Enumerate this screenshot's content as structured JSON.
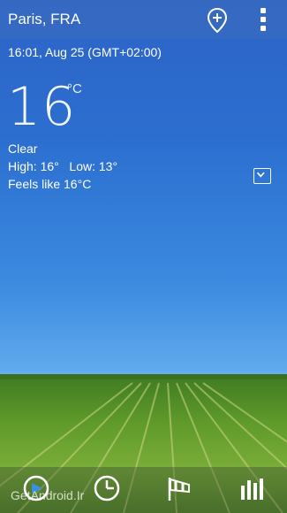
{
  "header": {
    "city": "Paris, FRA",
    "pin_icon": "add-location-pin-icon",
    "menu_icon": "overflow-menu-icon"
  },
  "weather": {
    "datetime": "16:01, Aug 25 (GMT+02:00)",
    "temperature": "16",
    "unit": "°C",
    "condition": "Clear",
    "high_low": "High: 16°   Low: 13°",
    "feels_like": "Feels like 16°C",
    "expand_icon": "chevron-down-icon"
  },
  "bottom_nav": {
    "items": [
      {
        "icon": "current-conditions-icon"
      },
      {
        "icon": "clock-icon"
      },
      {
        "icon": "windsock-icon"
      },
      {
        "icon": "bar-chart-icon"
      }
    ]
  },
  "watermark": "GetAndroid.Ir"
}
